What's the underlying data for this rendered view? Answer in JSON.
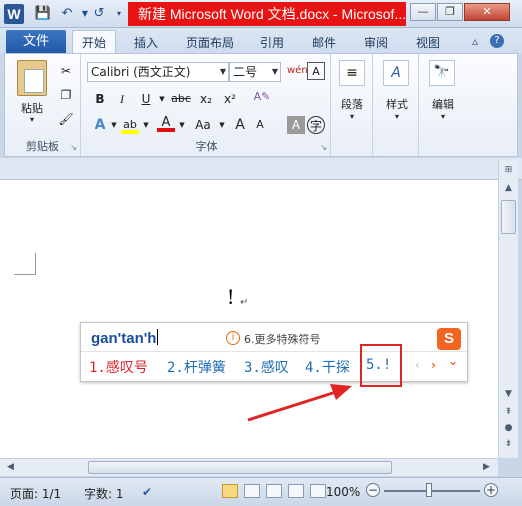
{
  "window": {
    "title": "新建 Microsoft Word 文档.docx - Microsof...",
    "app_icon": "W"
  },
  "qat": {
    "save": "save-icon",
    "undo": "undo-icon",
    "redo": "redo-icon"
  },
  "tabs": {
    "file": "文件",
    "items": [
      "开始",
      "插入",
      "页面布局",
      "引用",
      "邮件",
      "审阅",
      "视图"
    ]
  },
  "ribbon": {
    "clipboard": {
      "label": "剪贴板",
      "paste": "粘贴"
    },
    "font": {
      "label": "字体",
      "font_name": "Calibri (西文正文)",
      "font_size": "二号",
      "bold": "B",
      "italic": "I",
      "underline": "U",
      "strike": "abc",
      "subscript": "x₂",
      "superscript": "x²",
      "change_case": "Aa",
      "grow": "A",
      "shrink": "A"
    },
    "paragraph": {
      "label": "段落"
    },
    "styles": {
      "label": "样式"
    },
    "editing": {
      "label": "编辑"
    }
  },
  "document": {
    "text": "!",
    "para_mark": "↵"
  },
  "ime": {
    "input": "gan'tan'h",
    "hint": "6.更多特殊符号",
    "logo": "S",
    "candidates": [
      "1.感叹号",
      "2.杆弹簧",
      "3.感叹",
      "4.干探",
      "5.!"
    ],
    "nav_prev": "‹",
    "nav_next": "›",
    "nav_more": "⌄"
  },
  "status": {
    "page": "页面: 1/1",
    "words": "字数: 1",
    "zoom": "100%",
    "zoom_level_percent": 100
  },
  "colors": {
    "title_bar_highlight": "#e81313",
    "file_tab": "#2b5797",
    "candidate_first": "#d9262b",
    "candidate": "#1f6fb8",
    "annotation": "#e02424"
  }
}
